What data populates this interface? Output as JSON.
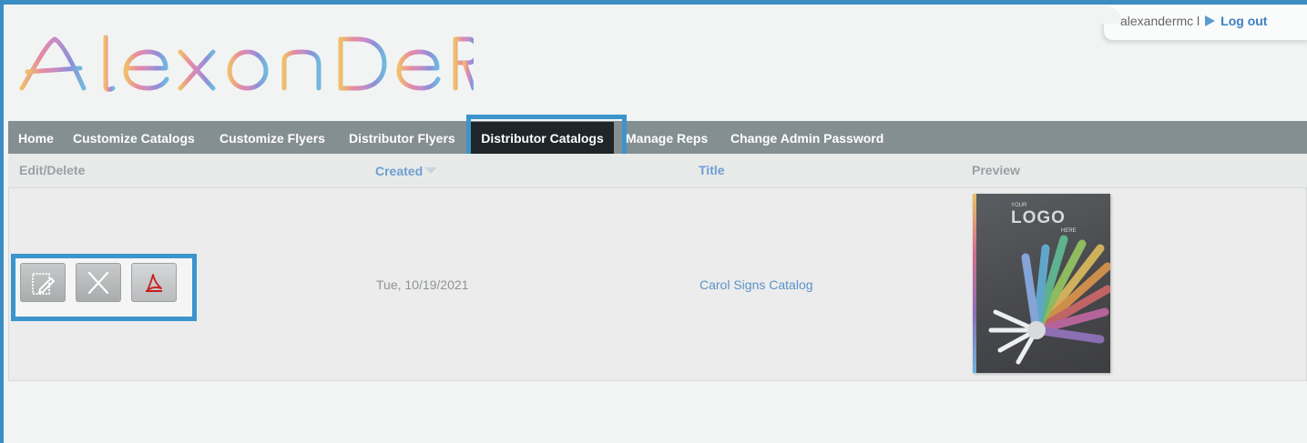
{
  "user_bar": {
    "username": "alexandermc l",
    "logout_label": "Log out"
  },
  "brand": {
    "logo_text": "ALEXANDER",
    "colors": [
      "#efbf6a",
      "#e58aa3",
      "#c58cc7",
      "#8d8fd7",
      "#70b9df"
    ]
  },
  "nav": {
    "items": [
      {
        "label": "Home"
      },
      {
        "label": "Customize Catalogs"
      },
      {
        "label": "Customize Flyers"
      },
      {
        "label": "Distributor Flyers"
      },
      {
        "label": "Distributor Catalogs",
        "active": true
      },
      {
        "label": "Manage Reps"
      },
      {
        "label": "Change Admin Password"
      }
    ]
  },
  "table": {
    "columns": [
      "Edit/Delete",
      "Created",
      "Title",
      "Preview"
    ],
    "sorted_column": "Created",
    "rows": [
      {
        "created": "Tue, 10/19/2021",
        "title": "Carol Signs Catalog",
        "actions": [
          "edit-icon",
          "delete-icon",
          "pdf-icon"
        ],
        "preview": {
          "logo_small_top": "YOUR",
          "logo_word": "LOGO",
          "logo_small_bottom": "HERE"
        }
      }
    ]
  },
  "accent_color": "#3c94cc"
}
